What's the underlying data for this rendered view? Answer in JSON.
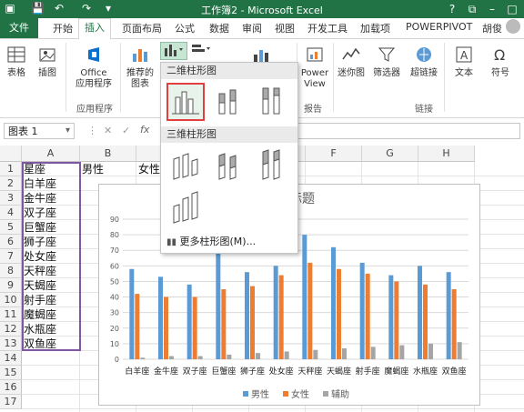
{
  "window": {
    "title": "工作簿2 - Microsoft Excel",
    "help": "?",
    "user": "胡俊"
  },
  "ribbon_tabs": {
    "file": "文件",
    "items": [
      "开始",
      "插入",
      "页面布局",
      "公式",
      "数据",
      "审阅",
      "视图",
      "开发工具",
      "加载项",
      "POWERPIVOT"
    ],
    "active": "插入"
  },
  "ribbon": {
    "table": "表格",
    "illustrations": "插图",
    "office_apps": "Office\n应用程序",
    "recommended_charts": "推荐的\n图表",
    "power_view": "Power\nView",
    "sparklines": "迷你图",
    "slicer": "筛选器",
    "hyperlink": "超链接",
    "text": "文本",
    "symbol": "符号",
    "group_apps": "应用程序",
    "group_reports": "报告",
    "group_links": "链接"
  },
  "namebox": {
    "value": "图表 1"
  },
  "columns": [
    "A",
    "B",
    "C",
    "D",
    "E",
    "F",
    "G",
    "H"
  ],
  "rows": [
    "1",
    "2",
    "3",
    "4",
    "5",
    "6",
    "7",
    "8",
    "9",
    "10",
    "11",
    "12",
    "13",
    "14",
    "15",
    "16",
    "17"
  ],
  "headers": {
    "a1": "星座",
    "b1": "男性",
    "c1": "女性"
  },
  "col_a": [
    "白羊座",
    "金牛座",
    "双子座",
    "巨蟹座",
    "狮子座",
    "处女座",
    "天秤座",
    "天蝎座",
    "射手座",
    "魔蝎座",
    "水瓶座",
    "双鱼座"
  ],
  "dropdown": {
    "section_2d": "二维柱形图",
    "section_3d": "三维柱形图",
    "more": "更多柱形图(M)..."
  },
  "chart_data": {
    "type": "bar",
    "title": "图表标题",
    "categories": [
      "白羊座",
      "金牛座",
      "双子座",
      "巨蟹座",
      "狮子座",
      "处女座",
      "天秤座",
      "天蝎座",
      "射手座",
      "魔蝎座",
      "水瓶座",
      "双鱼座"
    ],
    "ylim": [
      0,
      90
    ],
    "yticks": [
      0,
      10,
      20,
      30,
      40,
      50,
      60,
      70,
      80,
      90
    ],
    "series": [
      {
        "name": "男性",
        "color": "#5b9bd5",
        "values": [
          58,
          53,
          48,
          70,
          56,
          60,
          80,
          72,
          62,
          54,
          60,
          56
        ]
      },
      {
        "name": "女性",
        "color": "#ed7d31",
        "values": [
          42,
          40,
          40,
          45,
          47,
          54,
          62,
          58,
          55,
          50,
          48,
          45
        ]
      },
      {
        "name": "辅助",
        "color": "#a5a5a5",
        "values": [
          1,
          2,
          2,
          3,
          4,
          5,
          6,
          7,
          8,
          9,
          10,
          11
        ]
      }
    ],
    "legend": "bottom"
  },
  "colors": {
    "accent": "#217346",
    "selected_outline": "#e04040"
  }
}
